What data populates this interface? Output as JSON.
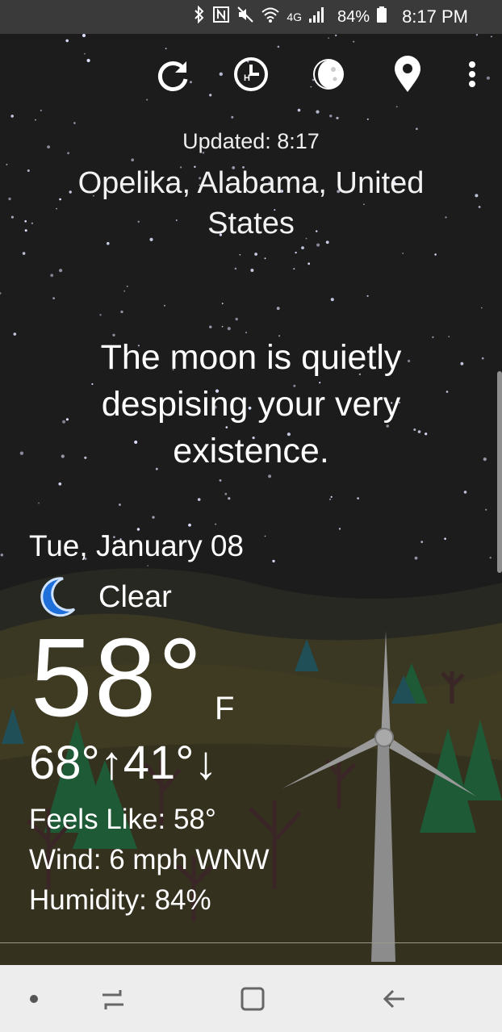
{
  "status_bar": {
    "network": "4G",
    "battery": "84%",
    "time": "8:17 PM",
    "icons": [
      "bluetooth-icon",
      "nfc-icon",
      "mute-icon",
      "wifi-icon",
      "signal-icon",
      "battery-icon"
    ]
  },
  "toolbar": {
    "items": [
      {
        "name": "refresh-icon"
      },
      {
        "name": "hourly-icon"
      },
      {
        "name": "moon-phase-icon"
      },
      {
        "name": "location-icon"
      },
      {
        "name": "more-options-icon"
      }
    ]
  },
  "weather": {
    "updated": "Updated: 8:17",
    "location": "Opelika, Alabama, United States",
    "message": "The moon is quietly despising your very existence.",
    "date": "Tue, January 08",
    "condition": "Clear",
    "condition_icon": "moon-icon",
    "temperature": "58°",
    "unit": "F",
    "high_low": "68°↑41°↓",
    "feels_like": "Feels Like: 58°",
    "wind": "Wind: 6 mph WNW",
    "humidity": "Humidity: 84%"
  },
  "nav_bar": {
    "buttons": [
      "dot-icon",
      "recents-icon",
      "home-icon",
      "back-icon"
    ]
  },
  "colors": {
    "sky": "#1c1c1c",
    "ground": "#2f2c20",
    "moon_blue": "#1e6fd9",
    "status_bg": "#3a3a3a",
    "nav_bg": "#ededed"
  }
}
